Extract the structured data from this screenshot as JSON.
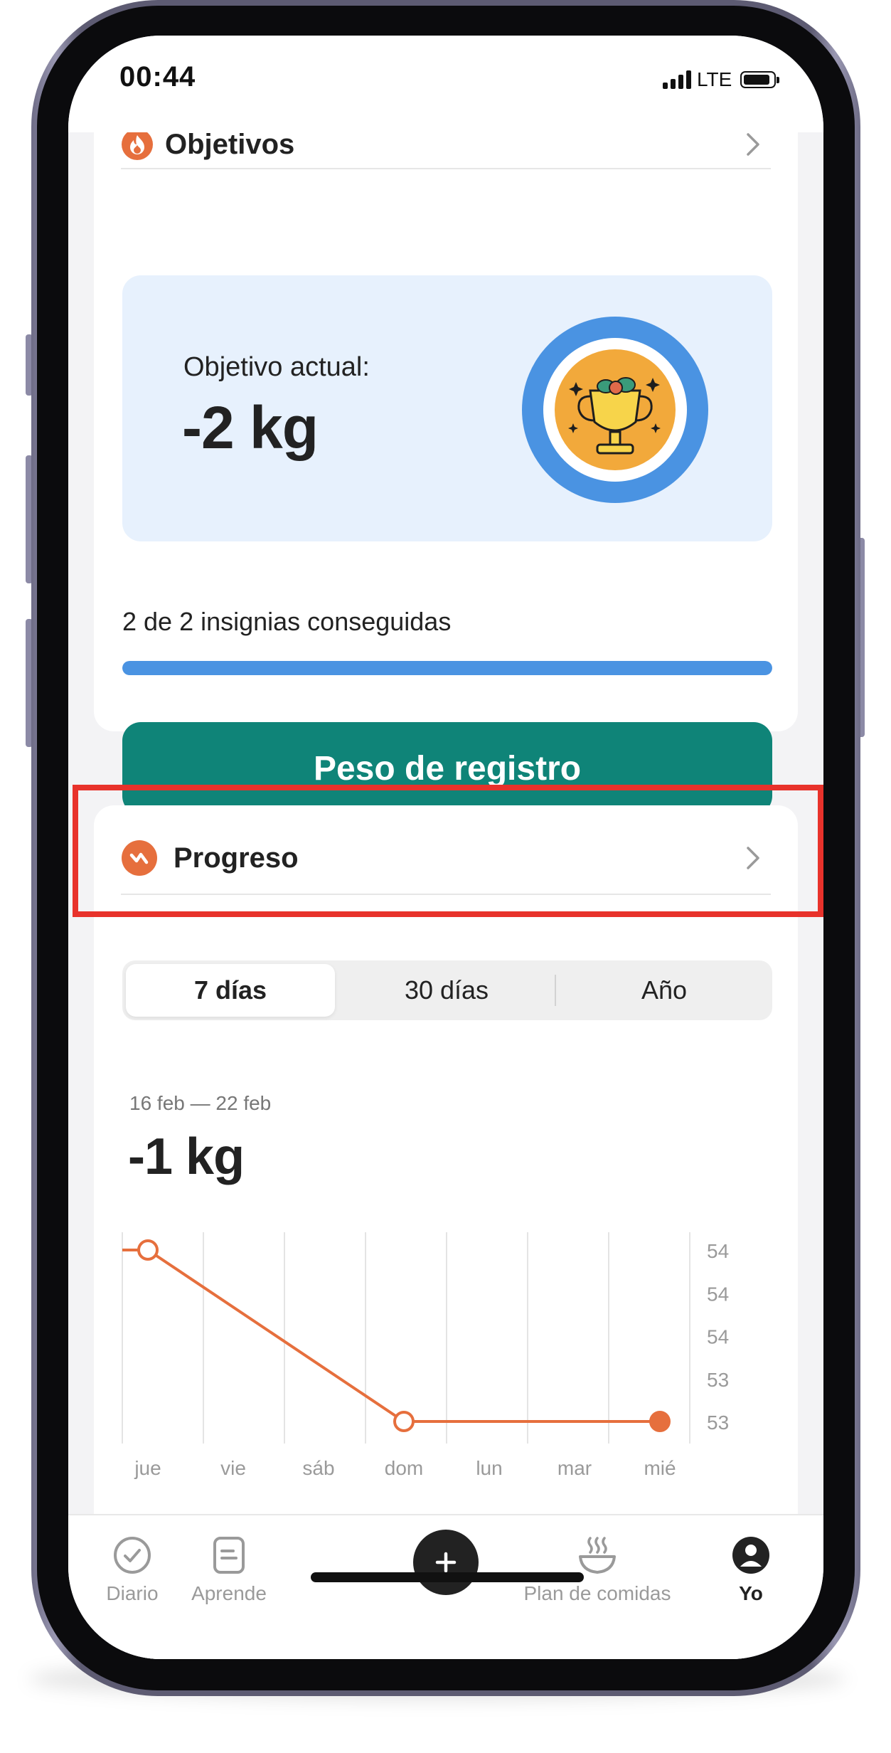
{
  "status_bar": {
    "time": "00:44",
    "network": "LTE"
  },
  "goals_card": {
    "title": "Objetivos",
    "current_goal_label": "Objetivo actual:",
    "current_goal_value": "-2 kg",
    "badges_text": "2 de 2 insignias conseguidas",
    "badges_progress": 1.0,
    "log_weight_button": "Peso de registro"
  },
  "progress_card": {
    "title": "Progreso",
    "tabs": [
      {
        "label": "7 días",
        "active": true
      },
      {
        "label": "30 días",
        "active": false
      },
      {
        "label": "Año",
        "active": false
      }
    ],
    "range_label": "16 feb — 22 feb",
    "range_value": "-1 kg"
  },
  "chart_data": {
    "type": "line",
    "categories": [
      "jue",
      "vie",
      "sáb",
      "dom",
      "lun",
      "mar",
      "mié"
    ],
    "y_tick_labels": [
      "54",
      "54",
      "54",
      "53",
      "53"
    ],
    "ylim": [
      53.0,
      54.0
    ],
    "series": [
      {
        "color": "#e66f3d",
        "points": [
          {
            "category": "jue",
            "value": 54.0,
            "marker": "hollow"
          },
          {
            "category": "dom",
            "value": 53.0,
            "marker": "hollow"
          },
          {
            "category": "mié",
            "value": 53.0,
            "marker": "filled"
          }
        ]
      }
    ],
    "grid": "vertical",
    "title": "",
    "xlabel": "",
    "ylabel": ""
  },
  "tab_bar": {
    "items": [
      {
        "label": "Diario",
        "icon": "check-circle-icon",
        "active": false
      },
      {
        "label": "Aprende",
        "icon": "document-icon",
        "active": false
      },
      {
        "label": "",
        "icon": "plus-icon",
        "active": false
      },
      {
        "label": "Plan de comidas",
        "icon": "bowl-icon",
        "active": false
      },
      {
        "label": "Yo",
        "icon": "profile-icon",
        "active": true
      }
    ]
  },
  "colors": {
    "accent_orange": "#e66f3d",
    "primary_button": "#0f8478",
    "progress_blue": "#4a93e2",
    "goal_box": "#e7f1fd",
    "highlight_border": "#e8322b"
  }
}
